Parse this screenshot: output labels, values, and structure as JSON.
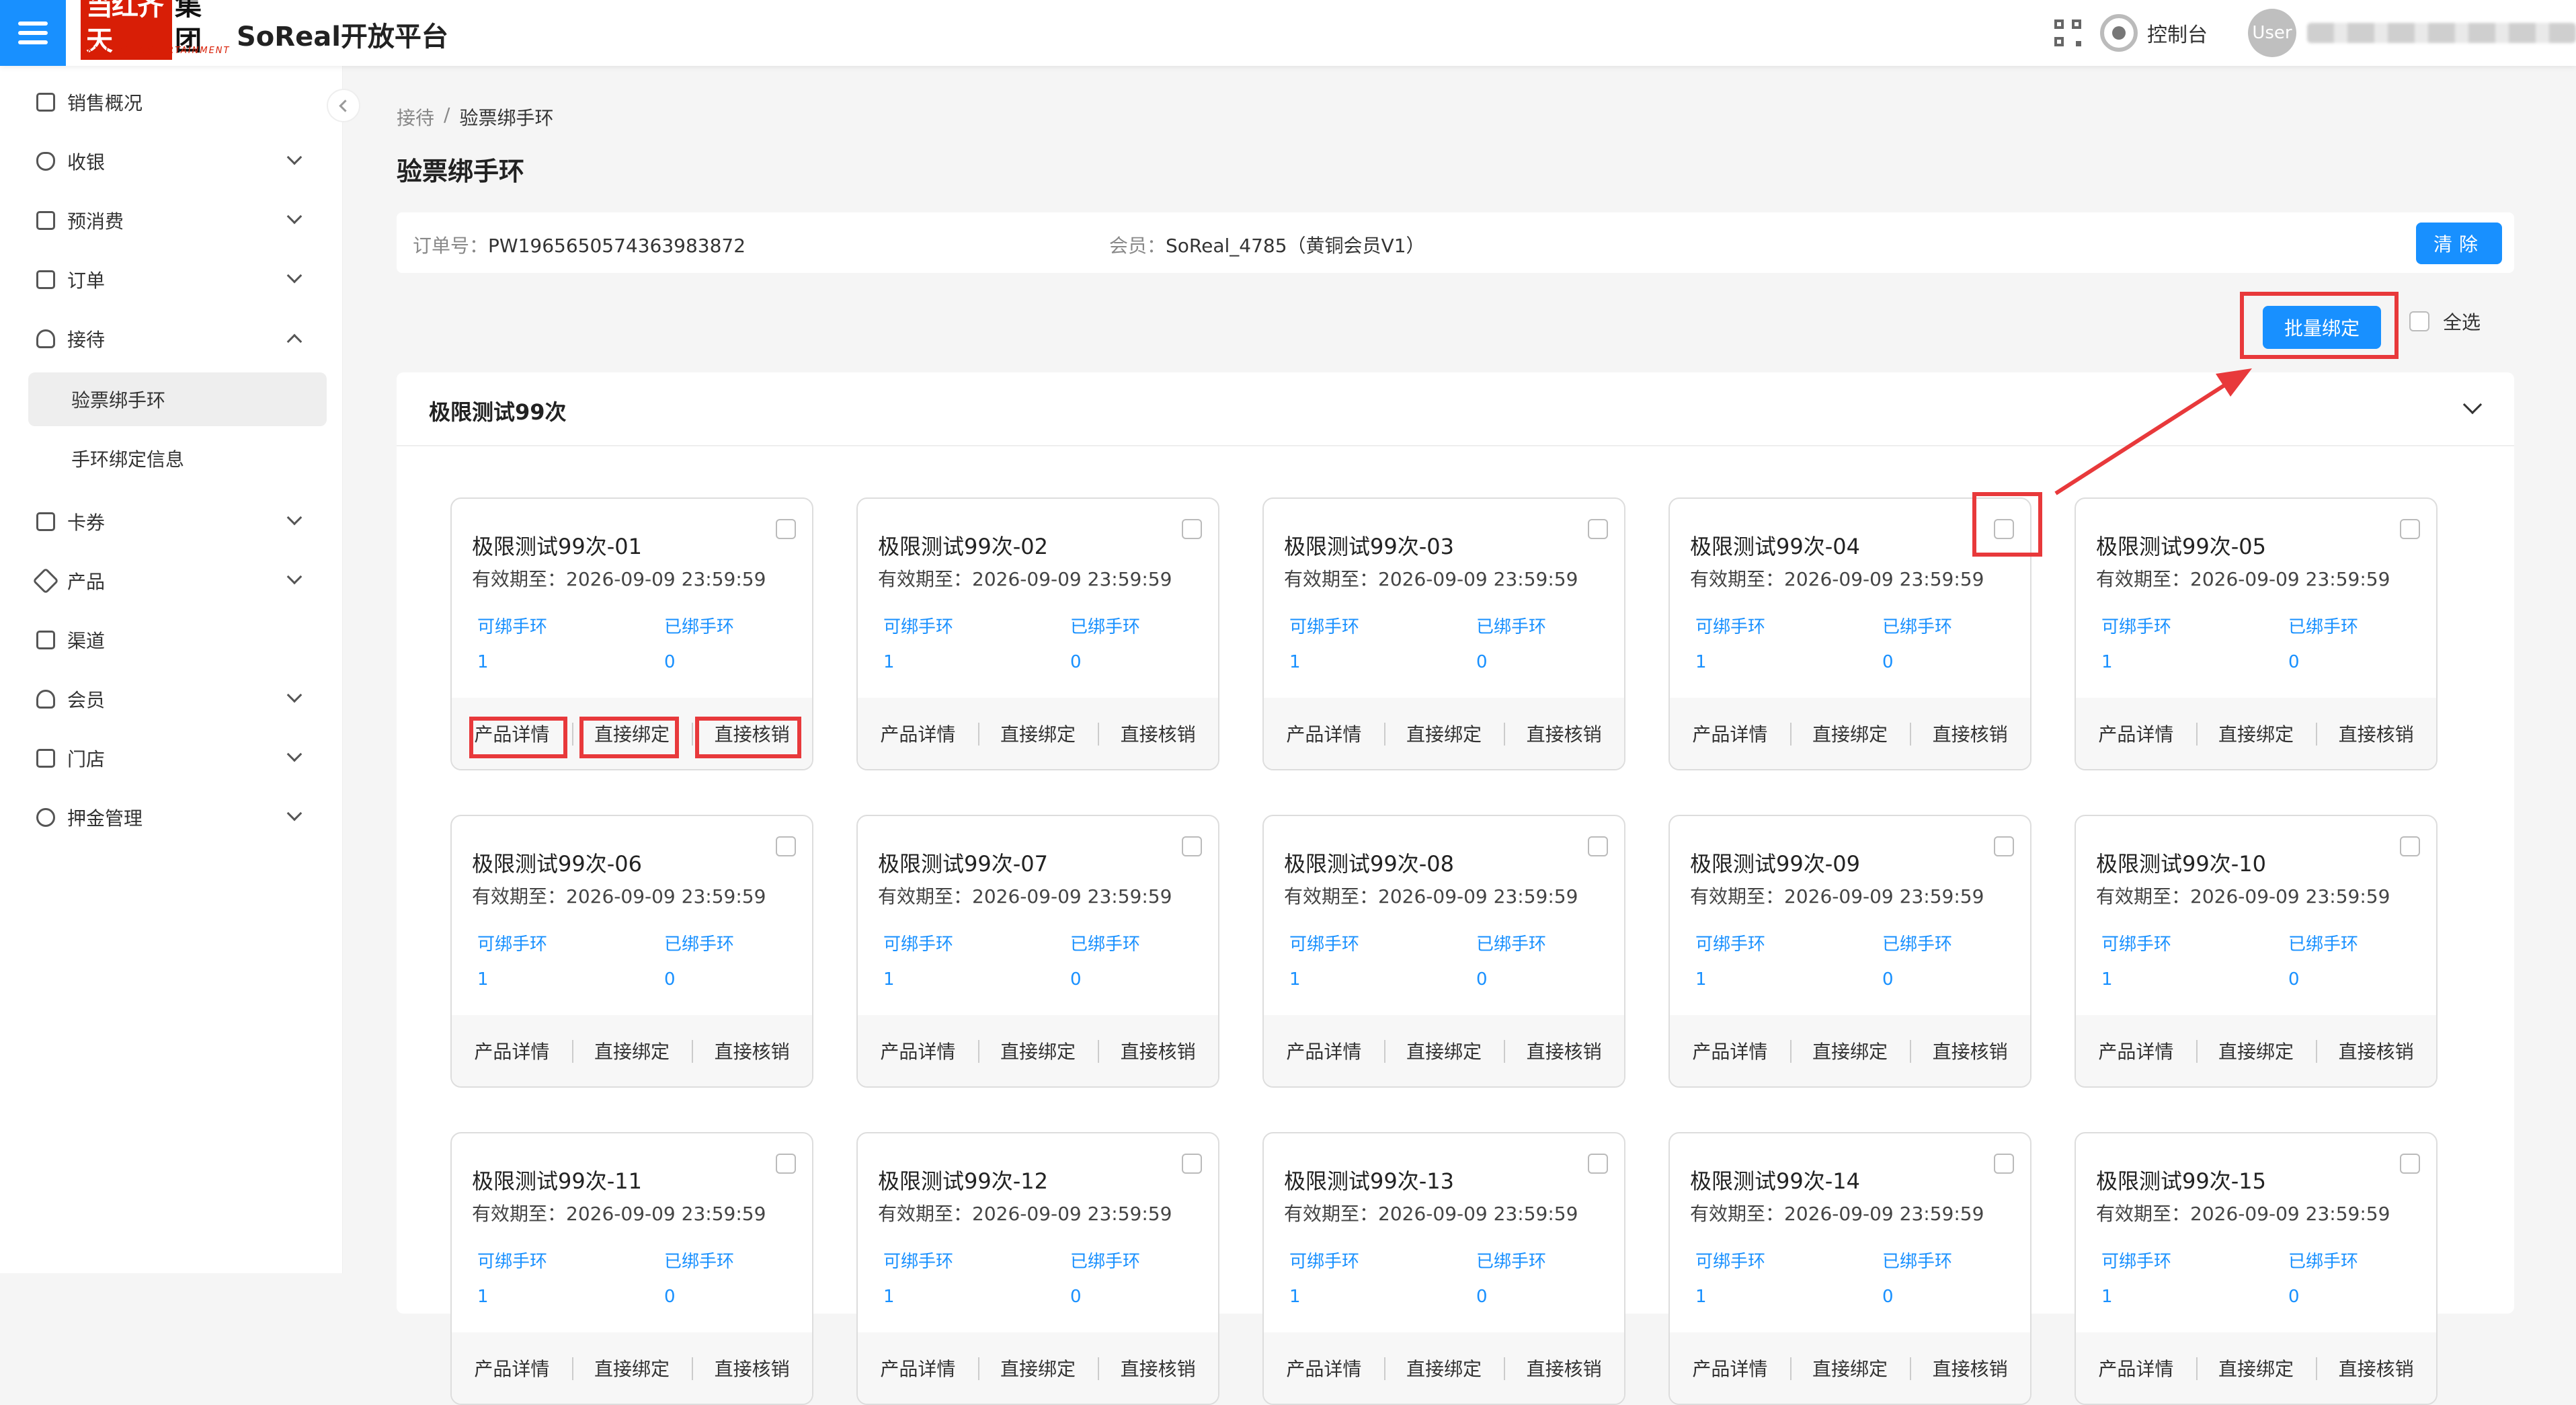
{
  "header": {
    "logo_main_red": "当红齐天",
    "logo_main_black": "集团",
    "logo_sub": "SKY LIMIT ENTERTAINMENT",
    "brand_title": "SoReal开放平台",
    "console_label": "控制台",
    "avatar_label": "User"
  },
  "sidebar": {
    "items": [
      {
        "label": "销售概况"
      },
      {
        "label": "收银"
      },
      {
        "label": "预消费"
      },
      {
        "label": "订单"
      },
      {
        "label": "接待"
      },
      {
        "label": "卡券"
      },
      {
        "label": "产品"
      },
      {
        "label": "渠道"
      },
      {
        "label": "会员"
      },
      {
        "label": "门店"
      },
      {
        "label": "押金管理"
      }
    ],
    "sub_items": [
      {
        "label": "验票绑手环"
      },
      {
        "label": "手环绑定信息"
      }
    ]
  },
  "breadcrumb": {
    "parent": "接待",
    "sep": "/",
    "current": "验票绑手环"
  },
  "page_title": "验票绑手环",
  "info_bar": {
    "order_label": "订单号：",
    "order_value": "PW1965650574363983872",
    "member_label": "会员：",
    "member_value": "SoReal_4785（黄铜会员V1）",
    "clear_label": "清除"
  },
  "batch_bind_label": "批量绑定",
  "select_all_label": "全选",
  "panel": {
    "title": "极限测试99次"
  },
  "card_common": {
    "exp_label": "有效期至：",
    "exp_value": "2026-09-09 23:59:59",
    "bindable_label": "可绑手环",
    "bound_label": "已绑手环",
    "bindable_value": "1",
    "bound_value": "0",
    "detail_label": "产品详情",
    "bind_label": "直接绑定",
    "verify_label": "直接核销"
  },
  "cards": [
    {
      "name": "极限测试99次-01"
    },
    {
      "name": "极限测试99次-02"
    },
    {
      "name": "极限测试99次-03"
    },
    {
      "name": "极限测试99次-04"
    },
    {
      "name": "极限测试99次-05"
    },
    {
      "name": "极限测试99次-06"
    },
    {
      "name": "极限测试99次-07"
    },
    {
      "name": "极限测试99次-08"
    },
    {
      "name": "极限测试99次-09"
    },
    {
      "name": "极限测试99次-10"
    },
    {
      "name": "极限测试99次-11"
    },
    {
      "name": "极限测试99次-12"
    },
    {
      "name": "极限测试99次-13"
    },
    {
      "name": "极限测试99次-14"
    },
    {
      "name": "极限测试99次-15"
    }
  ],
  "colors": {
    "primary": "#1890ff",
    "annotation": "#e8393b",
    "logo_red": "#d81e06"
  }
}
